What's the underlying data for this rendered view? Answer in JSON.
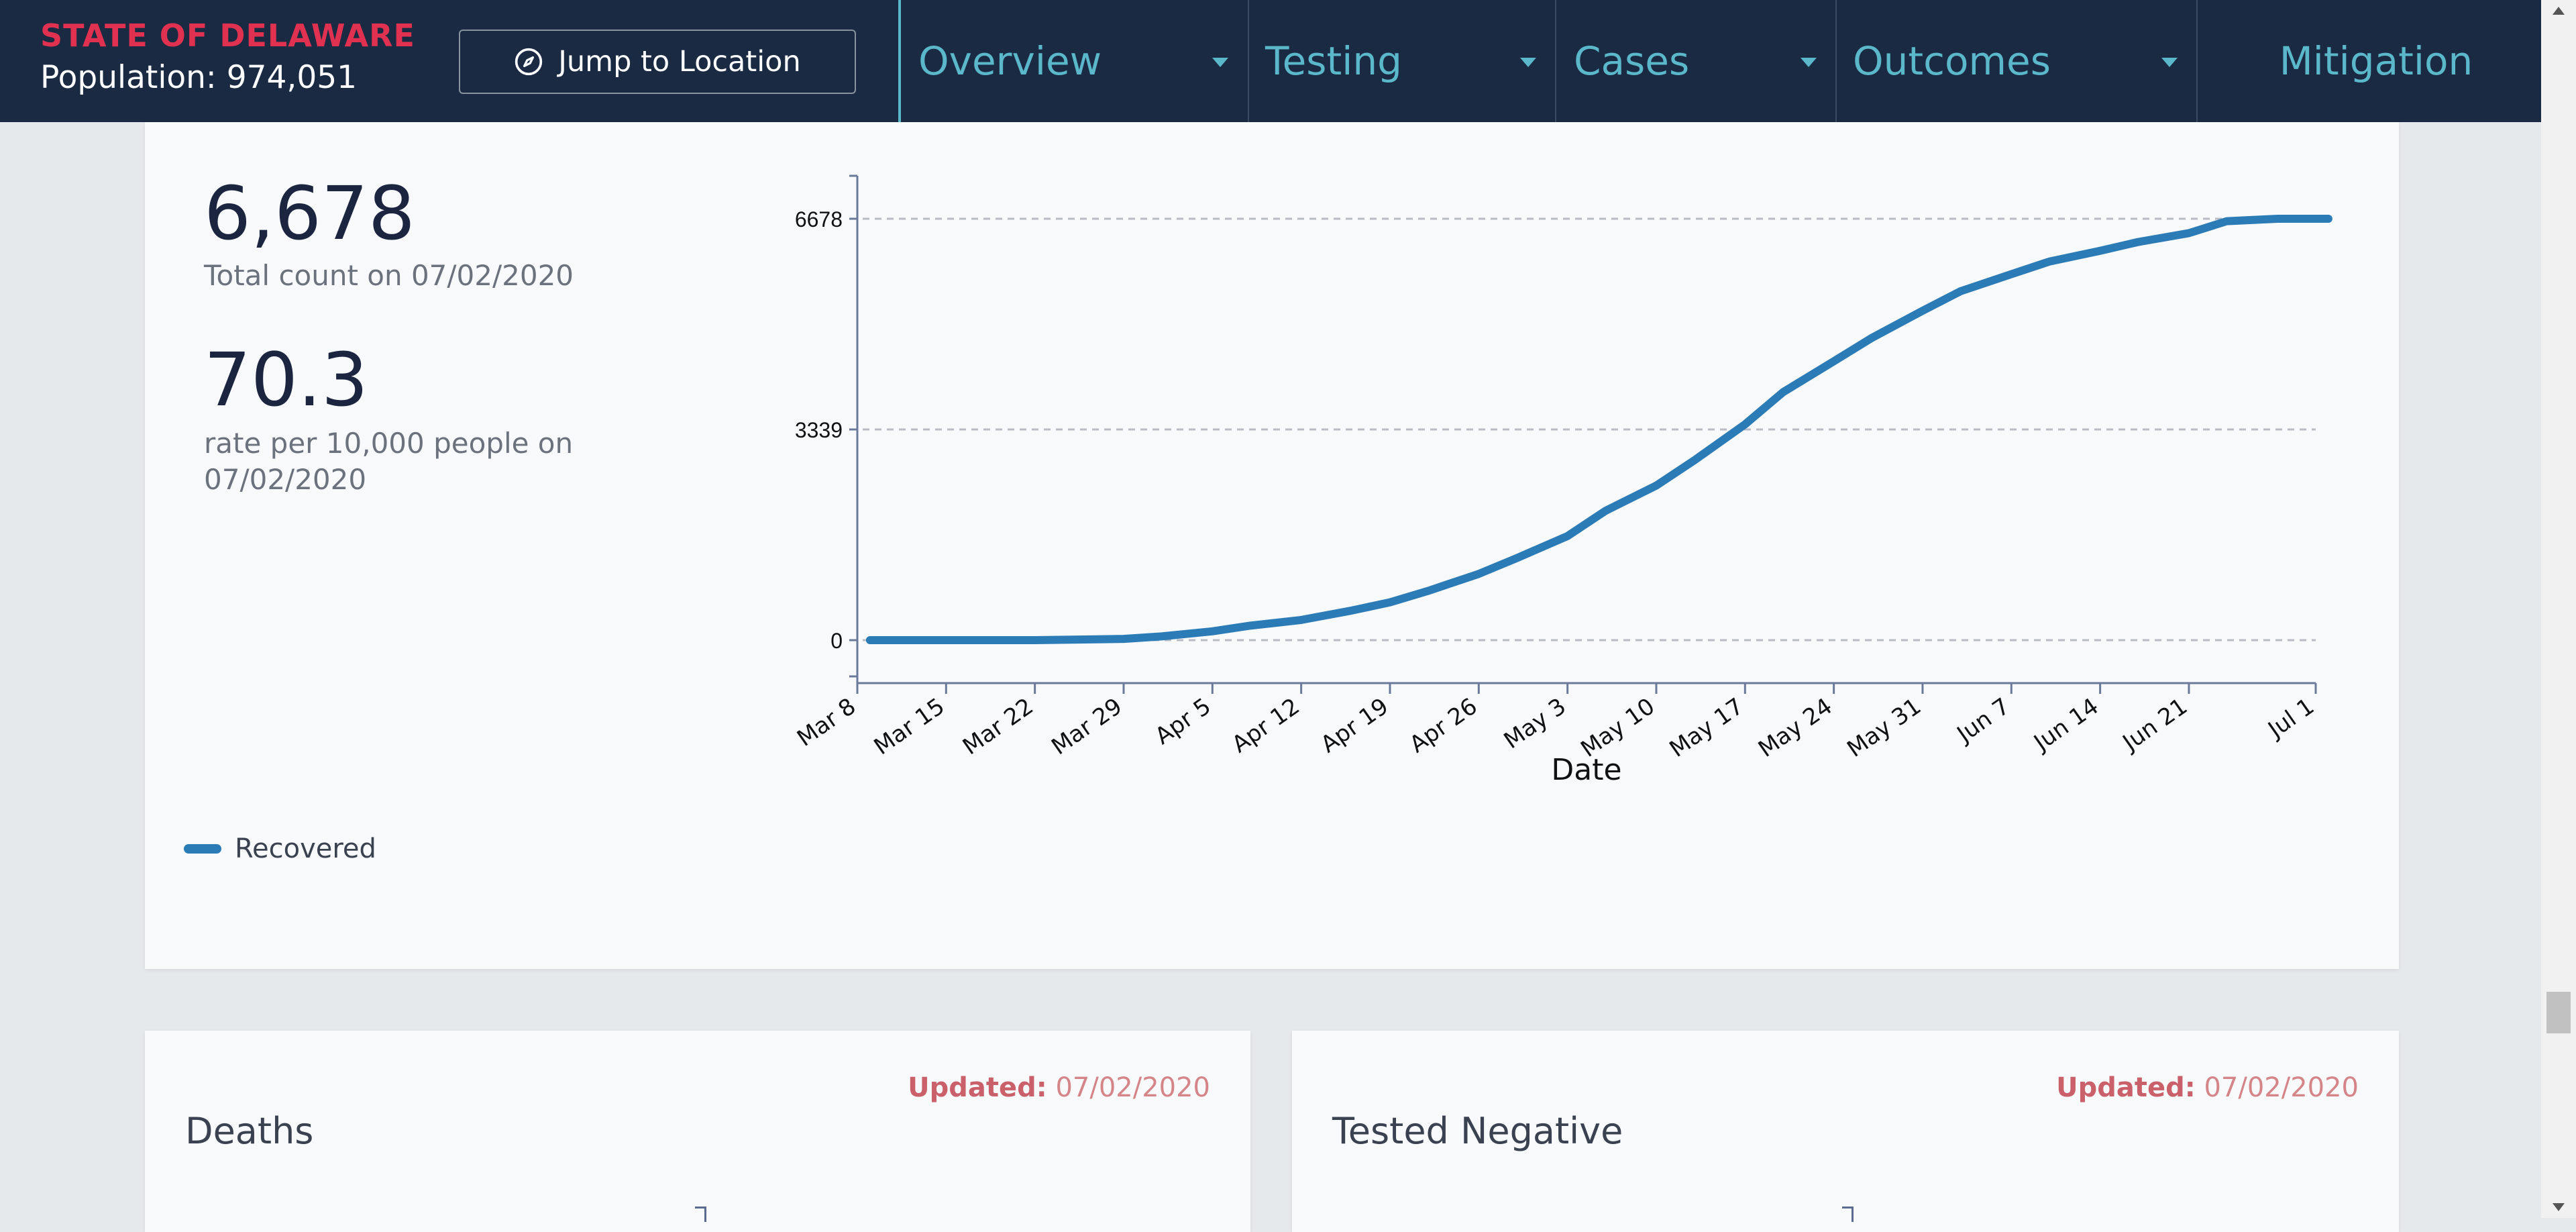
{
  "header": {
    "state_name": "STATE OF DELAWARE",
    "population": "Population: 974,051",
    "jump_button_label": "Jump to Location"
  },
  "nav_tabs": [
    {
      "label": "Overview",
      "has_dropdown": true
    },
    {
      "label": "Testing",
      "has_dropdown": true
    },
    {
      "label": "Cases",
      "has_dropdown": true
    },
    {
      "label": "Outcomes",
      "has_dropdown": true
    },
    {
      "label": "Mitigation",
      "has_dropdown": false
    }
  ],
  "recovered_card": {
    "total_value": "6,678",
    "total_caption": "Total count on 07/02/2020",
    "rate_value": "70.3",
    "rate_caption": "rate per 10,000 people on 07/02/2020",
    "legend_label": "Recovered"
  },
  "chart_data": {
    "type": "line",
    "xlabel": "Date",
    "ylabel": "",
    "x_tick_labels": [
      "Mar 8",
      "Mar 15",
      "Mar 22",
      "Mar 29",
      "Apr 5",
      "Apr 12",
      "Apr 19",
      "Apr 26",
      "May 3",
      "May 10",
      "May 17",
      "May 24",
      "May 31",
      "Jun 7",
      "Jun 14",
      "Jun 21",
      "Jul 1"
    ],
    "y_ticks": [
      0,
      3339,
      6678
    ],
    "ylim": [
      0,
      6678
    ],
    "grid": "horizontal dashed",
    "legend_position": "bottom-left",
    "series": [
      {
        "name": "Recovered",
        "color": "#2b7bb7",
        "x": [
          "Mar 9",
          "Mar 15",
          "Mar 22",
          "Mar 29",
          "Apr 1",
          "Apr 5",
          "Apr 8",
          "Apr 12",
          "Apr 16",
          "Apr 19",
          "Apr 22",
          "Apr 26",
          "Apr 29",
          "May 3",
          "May 6",
          "May 10",
          "May 13",
          "May 17",
          "May 20",
          "May 24",
          "May 27",
          "May 31",
          "Jun 3",
          "Jun 7",
          "Jun 10",
          "Jun 14",
          "Jun 17",
          "Jun 21",
          "Jun 24",
          "Jun 28",
          "Jul 2"
        ],
        "values": [
          0,
          0,
          0,
          20,
          60,
          140,
          230,
          320,
          470,
          600,
          780,
          1050,
          1300,
          1650,
          2050,
          2450,
          2850,
          3420,
          3930,
          4420,
          4790,
          5220,
          5530,
          5800,
          6000,
          6170,
          6310,
          6450,
          6640,
          6678,
          6678
        ]
      }
    ]
  },
  "bottom_cards": [
    {
      "updated_label": "Updated:",
      "updated_date": "07/02/2020",
      "title": "Deaths"
    },
    {
      "updated_label": "Updated:",
      "updated_date": "07/02/2020",
      "title": "Tested Negative"
    }
  ]
}
